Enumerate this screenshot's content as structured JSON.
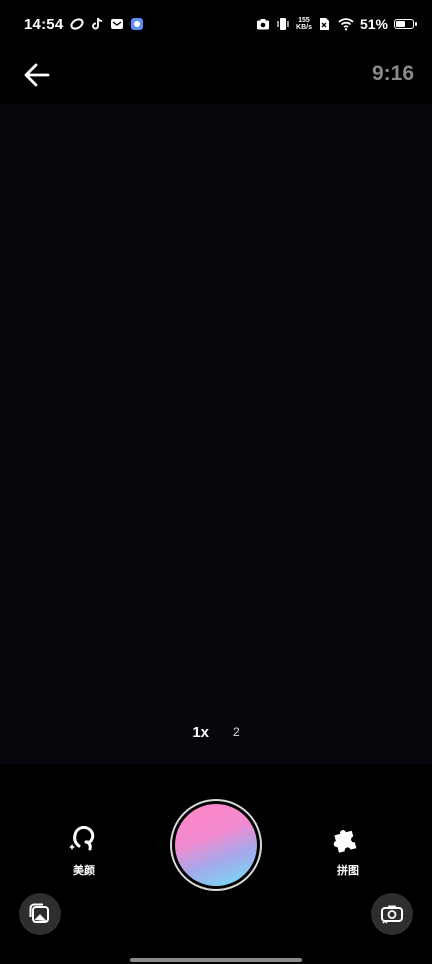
{
  "status_bar": {
    "time": "14:54",
    "net_speed_value": "155",
    "net_speed_unit": "KB/s",
    "battery_percent": "51%",
    "battery_level": 0.51,
    "left_icons": [
      "swirl-app-icon",
      "tiktok-icon",
      "mail-icon",
      "app-badge-icon"
    ],
    "right_icons": [
      "camera-indicator-icon",
      "vibrate-icon",
      "wifi-icon",
      "sim-off-icon"
    ]
  },
  "top_bar": {
    "back_icon": "arrow-left-icon",
    "aspect_ratio": "9:16"
  },
  "zoom": {
    "options": [
      "1x",
      "2"
    ],
    "selected": "1x"
  },
  "controls": {
    "beauty_label": "美颜",
    "beauty_icon": "beauty-face-icon",
    "puzzle_label": "拼图",
    "puzzle_icon": "puzzle-icon",
    "gallery_icon": "gallery-icon",
    "flip_icon": "flip-camera-icon",
    "shutter_colors": [
      "#ff86c5",
      "#6fe2f5"
    ]
  },
  "colors": {
    "background": "#000000",
    "viewfinder": "#07060c",
    "ratio_text": "#8a8a8a"
  }
}
